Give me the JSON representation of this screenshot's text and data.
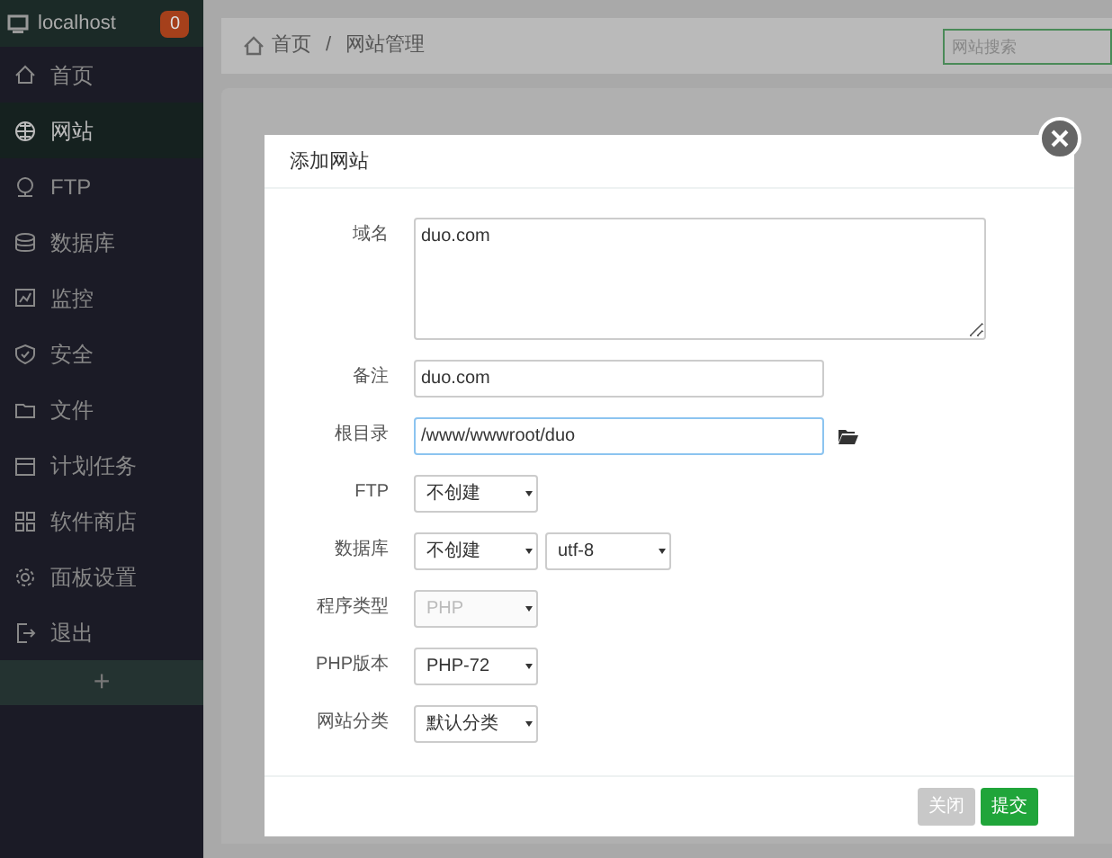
{
  "sidebar": {
    "host": "localhost",
    "badge": "0",
    "items": [
      {
        "label": "首页",
        "kind": "home",
        "selected": false
      },
      {
        "label": "网站",
        "kind": "globe",
        "selected": true
      },
      {
        "label": "FTP",
        "kind": "ftp",
        "selected": false
      },
      {
        "label": "数据库",
        "kind": "db",
        "selected": false
      },
      {
        "label": "监控",
        "kind": "monitor",
        "selected": false
      },
      {
        "label": "安全",
        "kind": "shield",
        "selected": false
      },
      {
        "label": "文件",
        "kind": "folder",
        "selected": false
      },
      {
        "label": "计划任务",
        "kind": "calendar",
        "selected": false
      },
      {
        "label": "软件商店",
        "kind": "grid",
        "selected": false
      },
      {
        "label": "面板设置",
        "kind": "gear",
        "selected": false
      },
      {
        "label": "退出",
        "kind": "exit",
        "selected": false
      }
    ],
    "add": "+"
  },
  "breadcrumb": [
    "首页",
    "/",
    "网站管理"
  ],
  "search": {
    "placeholder": "网站搜索"
  },
  "dialog": {
    "title": "添加网站",
    "fields": [
      {
        "kind": "textarea",
        "label": "域名",
        "value": "duo.com"
      },
      {
        "kind": "input",
        "label": "备注",
        "value": "duo.com"
      },
      {
        "kind": "path",
        "label": "根目录",
        "value": "/www/wwwroot/duo",
        "focused": true
      },
      {
        "kind": "select",
        "label": "FTP",
        "options": [
          {
            "value": "不创建",
            "disabled": false
          }
        ]
      },
      {
        "kind": "select",
        "label": "数据库",
        "options": [
          {
            "value": "不创建",
            "disabled": false
          },
          {
            "value": "utf-8",
            "disabled": false
          }
        ]
      },
      {
        "kind": "select",
        "label": "程序类型",
        "options": [
          {
            "value": "PHP",
            "disabled": true
          }
        ]
      },
      {
        "kind": "select",
        "label": "PHP版本",
        "options": [
          {
            "value": "PHP-72",
            "disabled": false
          }
        ]
      },
      {
        "kind": "select",
        "label": "网站分类",
        "options": [
          {
            "value": "默认分类",
            "disabled": false
          }
        ]
      }
    ],
    "buttons": [
      {
        "label": "关闭",
        "kind": "secondary"
      },
      {
        "label": "提交",
        "kind": "primary"
      }
    ]
  }
}
